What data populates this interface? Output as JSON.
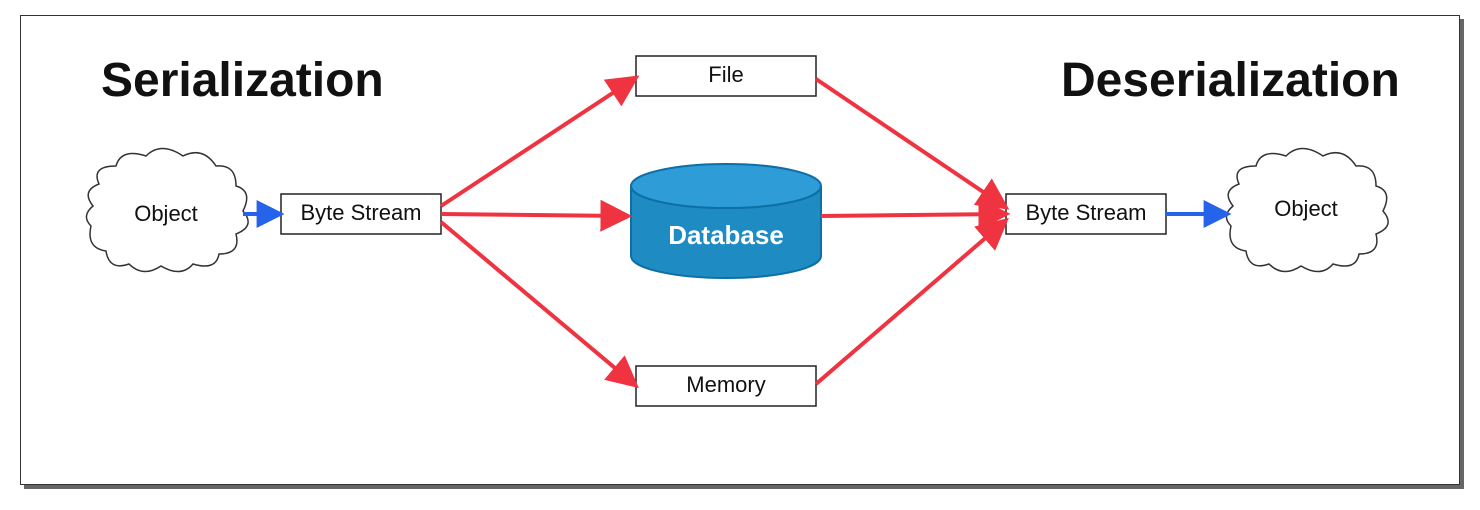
{
  "headings": {
    "left": "Serialization",
    "right": "Deserialization"
  },
  "nodes": {
    "object_left": "Object",
    "byte_stream_left": "Byte Stream",
    "file": "File",
    "database": "Database",
    "memory": "Memory",
    "byte_stream_right": "Byte Stream",
    "object_right": "Object"
  },
  "colors": {
    "blue_arrow": "#2563EB",
    "red_arrow": "#EF3340",
    "db_fill": "#1E8BC3",
    "db_stroke": "#0D6FA6",
    "box_stroke": "#222",
    "cloud_stroke": "#333"
  }
}
